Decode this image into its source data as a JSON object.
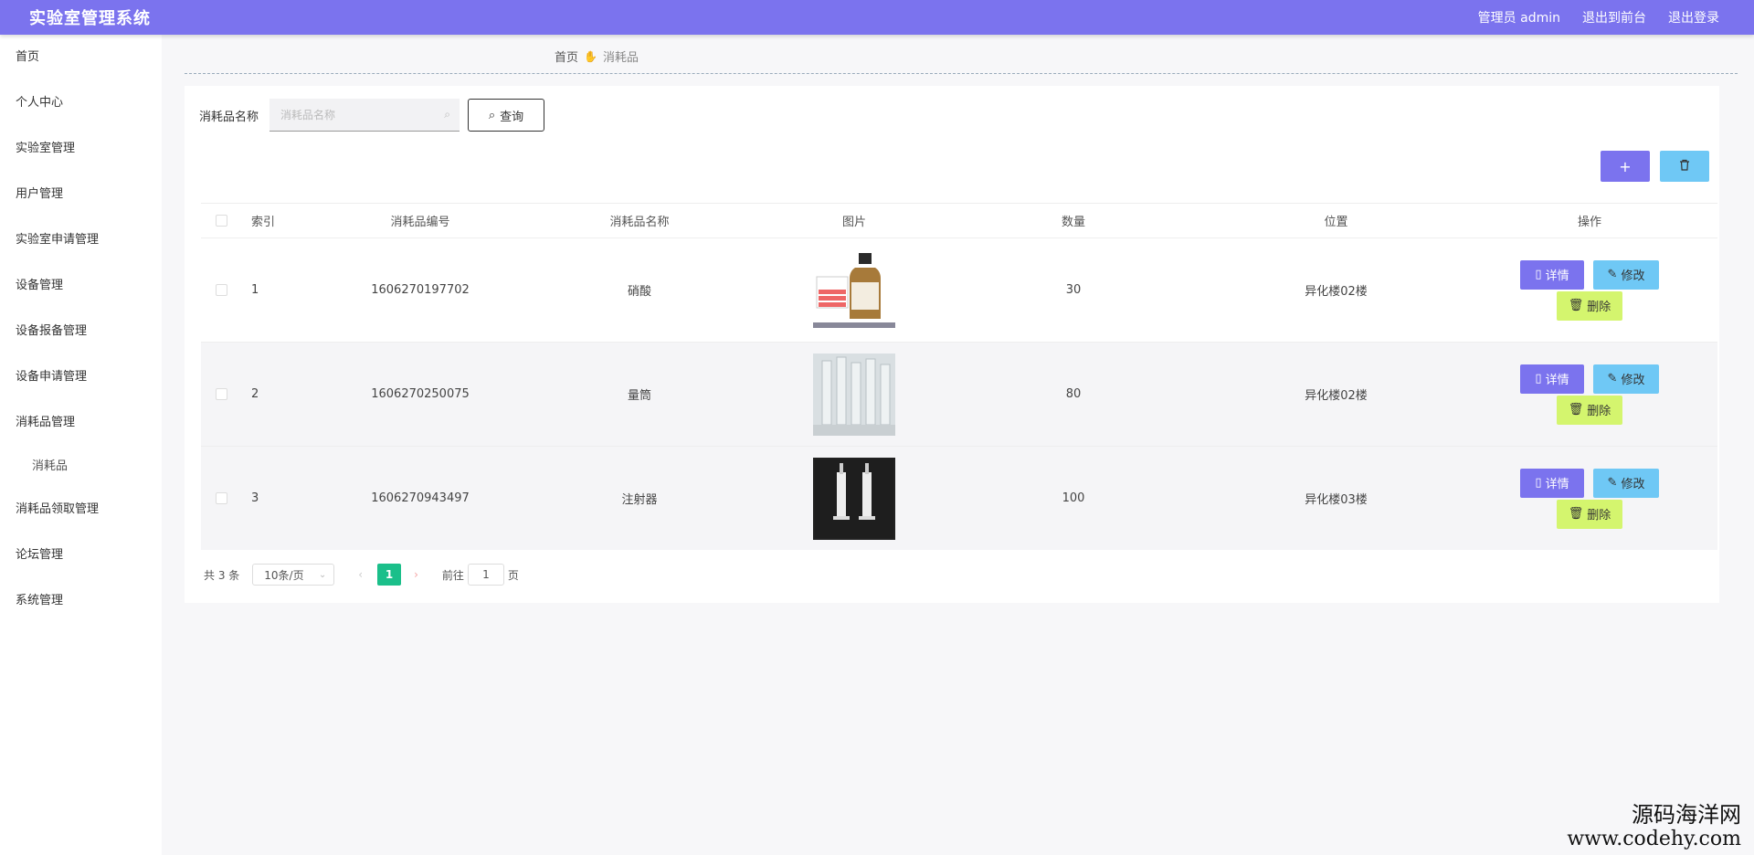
{
  "header": {
    "title": "实验室管理系统",
    "admin": "管理员 admin",
    "to_front": "退出到前台",
    "logout": "退出登录"
  },
  "sidebar": {
    "items": [
      {
        "label": "首页"
      },
      {
        "label": "个人中心"
      },
      {
        "label": "实验室管理"
      },
      {
        "label": "用户管理"
      },
      {
        "label": "实验室申请管理"
      },
      {
        "label": "设备管理"
      },
      {
        "label": "设备报备管理"
      },
      {
        "label": "设备申请管理"
      },
      {
        "label": "消耗品管理"
      },
      {
        "label": "消耗品",
        "sub": true
      },
      {
        "label": "消耗品领取管理"
      },
      {
        "label": "论坛管理"
      },
      {
        "label": "系统管理"
      }
    ]
  },
  "breadcrumb": {
    "home": "首页",
    "current": "消耗品"
  },
  "search": {
    "label": "消耗品名称",
    "placeholder": "消耗品名称",
    "button": "查询"
  },
  "toolbar": {
    "add": "+",
    "delete": "🗑"
  },
  "table": {
    "headers": [
      "索引",
      "消耗品编号",
      "消耗品名称",
      "图片",
      "数量",
      "位置",
      "操作"
    ],
    "rows": [
      {
        "index": "1",
        "code": "1606270197702",
        "name": "硝酸",
        "image": "bottle",
        "qty": "30",
        "location": "异化楼02楼"
      },
      {
        "index": "2",
        "code": "1606270250075",
        "name": "量筒",
        "image": "cylinders",
        "qty": "80",
        "location": "异化楼02楼"
      },
      {
        "index": "3",
        "code": "1606270943497",
        "name": "注射器",
        "image": "syringes",
        "qty": "100",
        "location": "异化楼03楼"
      }
    ],
    "ops": {
      "detail": "详情",
      "edit": "修改",
      "delete": "删除"
    }
  },
  "pager": {
    "total": "共 3 条",
    "size": "10条/页",
    "current_page": "1",
    "goto": "前往",
    "goto_value": "1",
    "page_suffix": "页"
  },
  "watermark": {
    "line1": "源码海洋网",
    "line2": "www.codehy.com"
  },
  "colors": {
    "primary": "#7b73ee",
    "info": "#6fc8f5",
    "warn": "#d4f56e",
    "page": "#1bbf8a"
  }
}
